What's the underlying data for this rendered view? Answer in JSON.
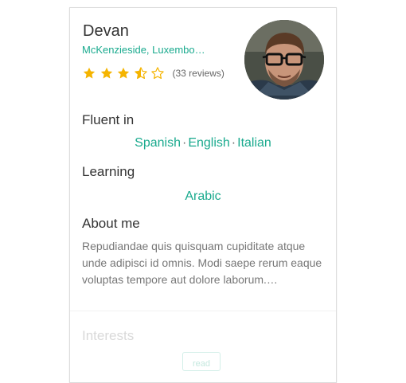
{
  "profile": {
    "name": "Devan",
    "location": "McKenzieside, Luxembo…",
    "rating": 3.5,
    "rating_max": 5,
    "reviews": "(33 reviews)"
  },
  "sections": {
    "fluent_title": "Fluent in",
    "fluent_languages": [
      "Spanish",
      "English",
      "Italian"
    ],
    "learning_title": "Learning",
    "learning_languages": [
      "Arabic"
    ],
    "about_title": "About me",
    "about_text": "Repudiandae quis quisquam cupiditate atque unde adipisci id omnis. Modi saepe rerum eaque voluptas tempore aut dolore laborum.…",
    "interests_title": "Interests",
    "interests": [
      "read"
    ]
  },
  "separator": "·",
  "colors": {
    "accent": "#1aaa8e",
    "star": "#f5b400",
    "text": "#333333",
    "muted": "#777777"
  }
}
